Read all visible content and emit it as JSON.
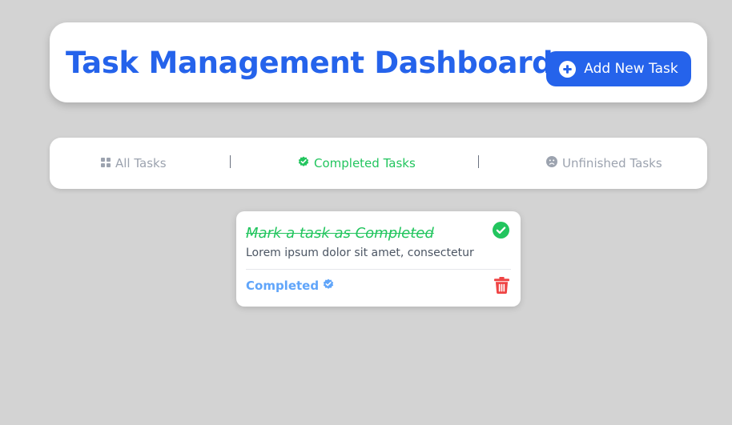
{
  "header": {
    "title": "Task Management Dashboard",
    "add_button_label": "Add New Task",
    "add_icon": "plus-circle-icon"
  },
  "tabs": [
    {
      "label": "All Tasks",
      "icon": "grid-icon",
      "active": false
    },
    {
      "label": "Completed Tasks",
      "icon": "check-badge-icon",
      "active": true
    },
    {
      "label": "Unfinished Tasks",
      "icon": "frown-icon",
      "active": false
    }
  ],
  "tasks": [
    {
      "title": "Mark a task as Completed",
      "description": "Lorem ipsum dolor sit amet, consectetur",
      "status": "Completed",
      "status_icon": "verified-badge-icon",
      "complete_icon": "check-circle-icon",
      "delete_icon": "trash-icon"
    }
  ],
  "colors": {
    "background": "#d3d3d3",
    "primary": "#2563eb",
    "success": "#22c55e",
    "status": "#60a5fa",
    "danger": "#ef4444",
    "muted": "#9ca3af"
  }
}
